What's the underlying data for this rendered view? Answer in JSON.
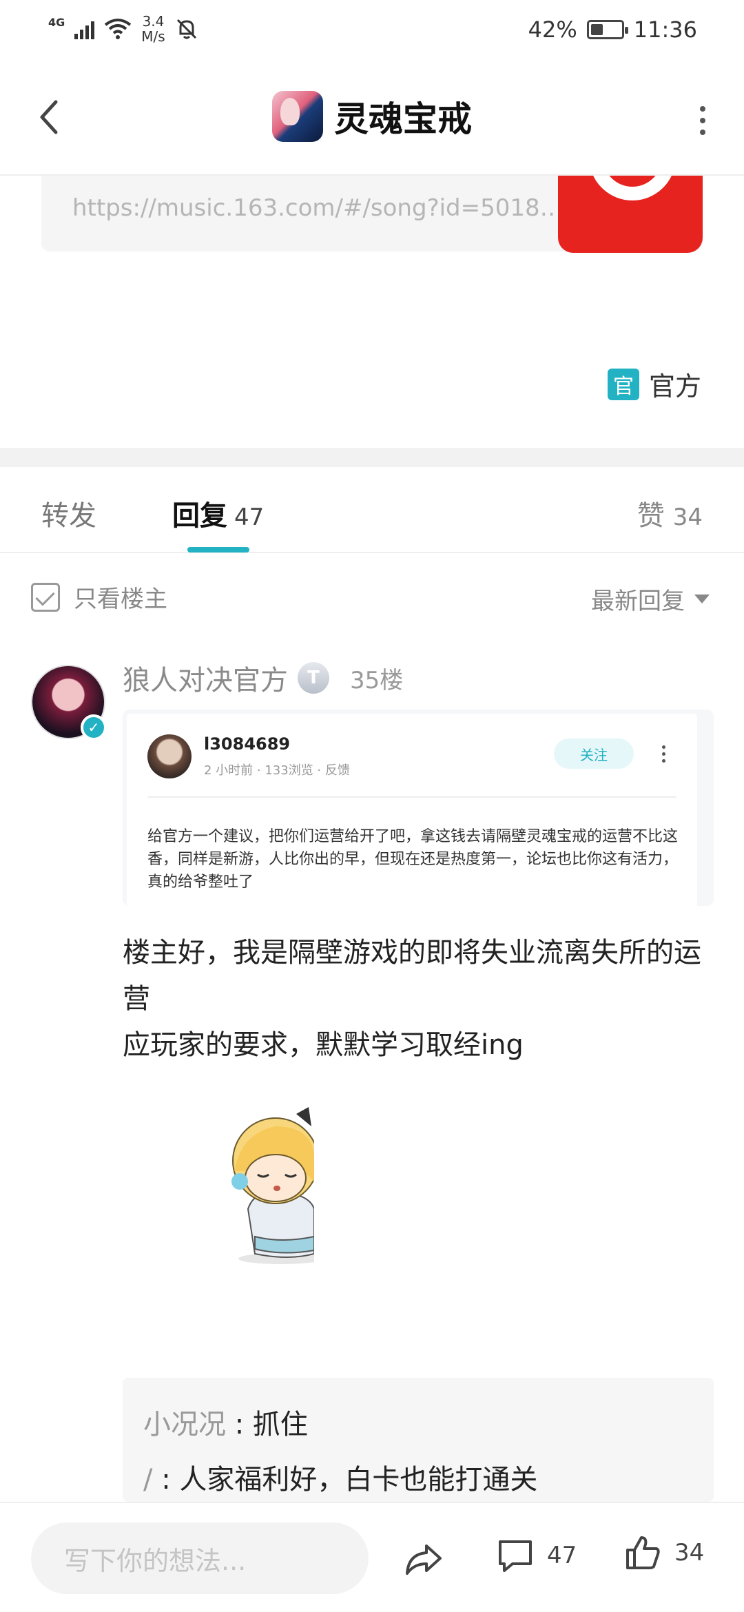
{
  "status_bar": {
    "network": "4G",
    "speed_value": "3.4",
    "speed_unit": "M/s",
    "battery": "42%",
    "battery_level": 0.42,
    "time": "11:36"
  },
  "header": {
    "title": "灵魂宝戒"
  },
  "link_card": {
    "url": "https://music.163.com/#/song?id=50182..."
  },
  "official_tag": {
    "badge": "官",
    "label": "官方"
  },
  "tabs": {
    "forward": "转发",
    "reply": "回复",
    "reply_count": "47",
    "like": "赞",
    "like_count": "34"
  },
  "filter": {
    "only_owner": "只看楼主",
    "sort": "最新回复"
  },
  "post": {
    "author": "狼人对决官方",
    "level_badge": "T",
    "floor": "35楼",
    "quote": {
      "user": "l3084689",
      "meta": "2 小时前 · 133浏览 · 反馈",
      "follow": "关注",
      "body": "给官方一个建议，把你们运营给开了吧，拿这钱去请隔壁灵魂宝戒的运营不比这香，同样是新游，人比你出的早，但现在还是热度第一，论坛也比你这有活力，真的给爷整吐了"
    },
    "text": "楼主好，我是隔壁游戏的即将失业流离失所的运营\n应玩家的要求，默默学习取经ing"
  },
  "sub_replies": [
    {
      "user": "小况况",
      "sep": " : ",
      "text": "抓住"
    },
    {
      "user": "/",
      "sep": " : ",
      "text": "人家福利好，白卡也能打通关"
    }
  ],
  "bottom_bar": {
    "placeholder": "写下你的想法...",
    "comment_count": "47",
    "like_count": "34"
  },
  "colors": {
    "accent": "#22b2c4",
    "music_red": "#e6231f"
  }
}
